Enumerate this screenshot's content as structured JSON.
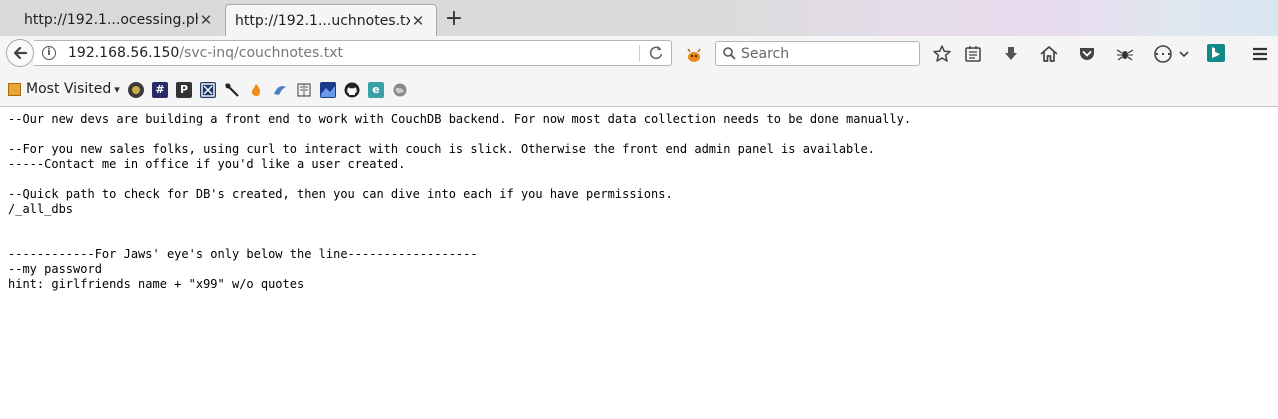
{
  "tabs": [
    {
      "title": "http://192.1...ocessing.php",
      "active": false
    },
    {
      "title": "http://192.1...uchnotes.txt",
      "active": true
    }
  ],
  "tab_close_glyph": "✕",
  "new_tab_glyph": "+",
  "navbar": {
    "url_host": "192.168.56.150",
    "url_path": "/svc-inq/couchnotes.txt",
    "search_placeholder": "Search"
  },
  "bookmarks": {
    "most_visited_label": "Most Visited",
    "chevron": "▾",
    "favicons": [
      "favicon-olive",
      "favicon-hash",
      "favicon-p",
      "favicon-x-square",
      "favicon-tool",
      "favicon-flame",
      "favicon-dragon",
      "favicon-book",
      "favicon-image",
      "github-icon",
      "favicon-e",
      "globe-icon"
    ]
  },
  "content": {
    "lines": [
      "--Our new devs are building a front end to work with CouchDB backend. For now most data collection needs to be done manually.",
      "",
      "--For you new sales folks, using curl to interact with couch is slick. Otherwise the front end admin panel is available.",
      "-----Contact me in office if you'd like a user created.",
      "",
      "--Quick path to check for DB's created, then you can dive into each if you have permissions.",
      "/_all_dbs",
      "",
      "",
      "------------For Jaws' eye's only below the line------------------",
      "--my password",
      "hint: girlfriends name + \"x99\" w/o quotes"
    ]
  },
  "colors": {
    "text": "#000000",
    "bing": "#138a8a",
    "orange": "#e8a435"
  }
}
